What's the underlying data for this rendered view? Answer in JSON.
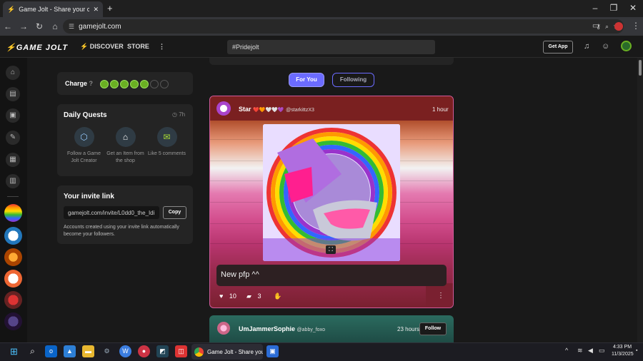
{
  "browser": {
    "tab_title": "Game Jolt - Share your creation",
    "url": "gamejolt.com"
  },
  "appbar": {
    "logo": "GAME JOLT",
    "discover": "DISCOVER",
    "store": "STORE",
    "search_value": "#Pridejolt",
    "get_app": "Get App"
  },
  "charge": {
    "label": "Charge",
    "filled": 5,
    "total": 7
  },
  "quests": {
    "title": "Daily Quests",
    "time": "7h",
    "items": [
      {
        "label": "Follow a Game Jolt Creator"
      },
      {
        "label": "Get an Item from the shop"
      },
      {
        "label": "Like 5 comments"
      }
    ]
  },
  "invite": {
    "title": "Your invite link",
    "link": "gamejolt.com/invite/L0dd0_the_Idi",
    "copy": "Copy",
    "note": "Accounts created using your invite link automatically become your followers."
  },
  "feed_tabs": {
    "for_you": "For You",
    "following": "Following"
  },
  "post1": {
    "author": "Star",
    "hearts": "❤️🧡🤍🤍💜",
    "handle": "@starkittzX3",
    "time": "1 hour",
    "caption": "New pfp ^^",
    "likes": "10",
    "comments": "3"
  },
  "post2": {
    "author": "UmJammerSophie",
    "handle": "@abby_foxo",
    "time": "23 hours",
    "follow": "Follow"
  },
  "taskbar": {
    "active_app": "Game Jolt - Share your c",
    "time": "4:33 PM",
    "date": "11/3/2025"
  },
  "colors": {
    "accent": "#6b6bff",
    "charge": "#6ab023"
  }
}
